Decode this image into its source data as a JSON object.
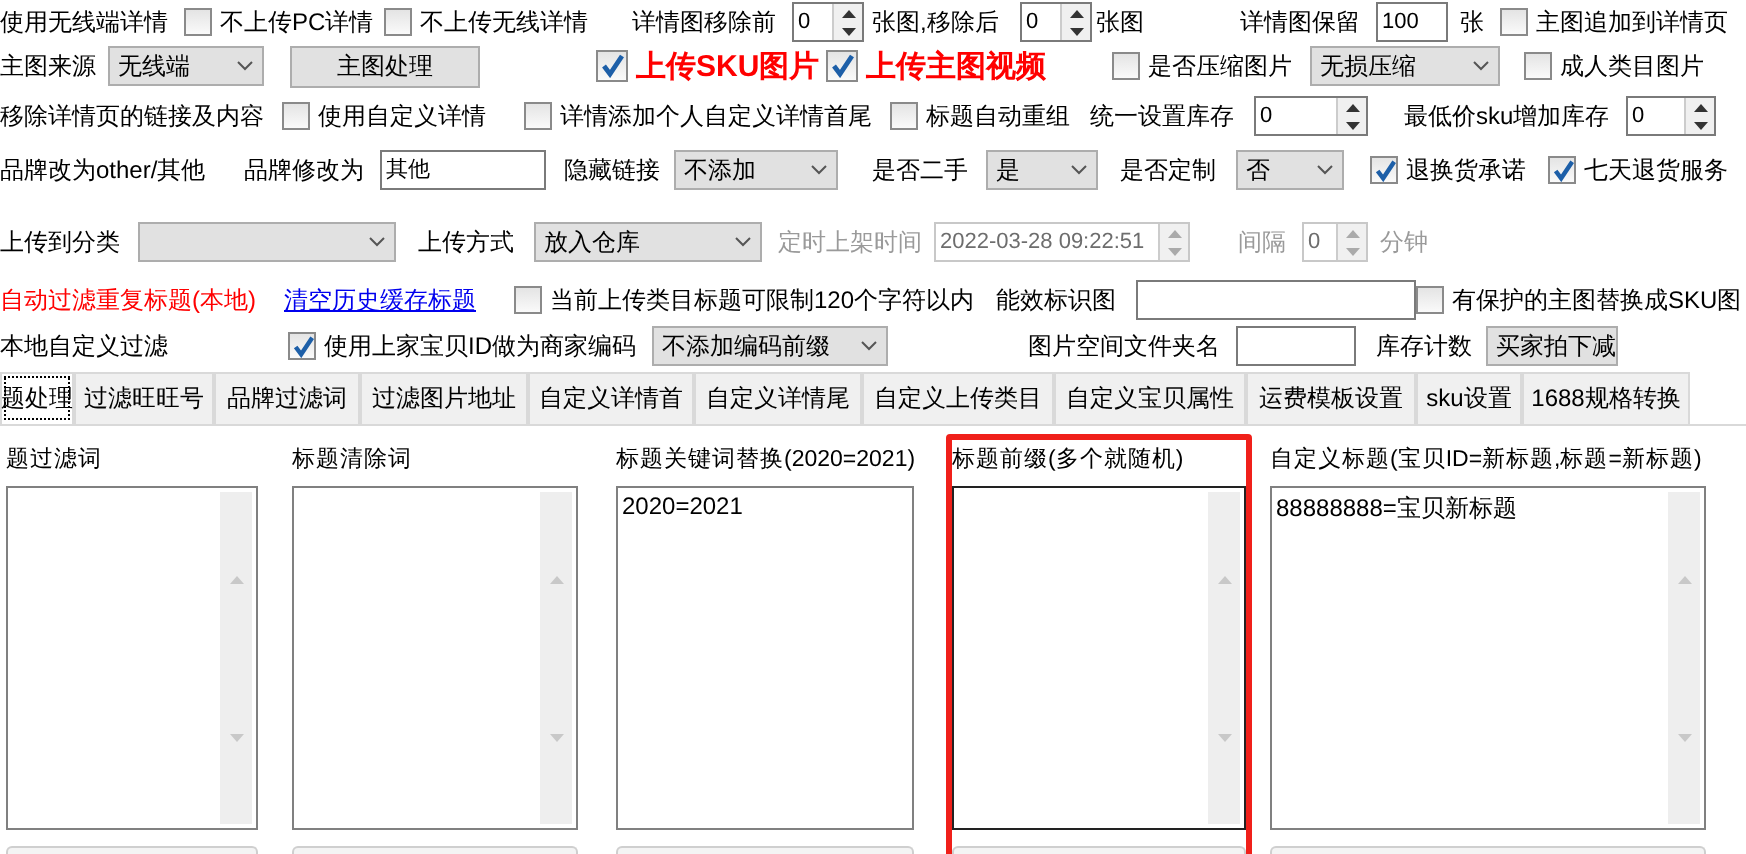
{
  "option_rows": [
    {
      "items": [
        {
          "kind": "label",
          "text": "使用无线端详情"
        },
        {
          "kind": "checkbox",
          "text": "不上传PC详情",
          "checked": false
        },
        {
          "kind": "checkbox",
          "text": "不上传无线详情",
          "checked": false
        },
        {
          "kind": "label",
          "text": "详情图移除前"
        },
        {
          "kind": "spin",
          "value": "0"
        },
        {
          "kind": "label",
          "text": "张图,移除后"
        },
        {
          "kind": "spin",
          "value": "0"
        },
        {
          "kind": "label",
          "text": "张图"
        },
        {
          "kind": "label",
          "text": "详情图保留"
        },
        {
          "kind": "input",
          "value": "100"
        },
        {
          "kind": "label",
          "text": "张"
        },
        {
          "kind": "checkbox",
          "text": "主图追加到详情页",
          "checked": false
        }
      ]
    },
    {
      "items": [
        {
          "kind": "label",
          "text": "主图来源"
        },
        {
          "kind": "select",
          "value": "无线端"
        },
        {
          "kind": "button",
          "text": "主图处理"
        },
        {
          "kind": "bigcheck",
          "text": "上传SKU图片",
          "checked": true
        },
        {
          "kind": "bigcheck",
          "text": "上传主图视频",
          "checked": true
        },
        {
          "kind": "checkbox",
          "text": "是否压缩图片",
          "checked": false
        },
        {
          "kind": "select",
          "value": "无损压缩"
        },
        {
          "kind": "checkbox",
          "text": "成人类目图片",
          "checked": false
        }
      ]
    },
    {
      "items": [
        {
          "kind": "label",
          "text": "移除详情页的链接及内容"
        },
        {
          "kind": "checkbox",
          "text": "使用自定义详情",
          "checked": false
        },
        {
          "kind": "checkbox",
          "text": "详情添加个人自定义详情首尾",
          "checked": false
        },
        {
          "kind": "checkbox",
          "text": "标题自动重组",
          "checked": false
        },
        {
          "kind": "label",
          "text": "统一设置库存"
        },
        {
          "kind": "spin",
          "value": "0"
        },
        {
          "kind": "label",
          "text": "最低价sku增加库存"
        },
        {
          "kind": "spin",
          "value": "0"
        }
      ]
    },
    {
      "items": [
        {
          "kind": "label",
          "text": "品牌改为other/其他"
        },
        {
          "kind": "label",
          "text": "品牌修改为"
        },
        {
          "kind": "input",
          "value": "其他"
        },
        {
          "kind": "label",
          "text": "隐藏链接"
        },
        {
          "kind": "select",
          "value": "不添加"
        },
        {
          "kind": "label",
          "text": "是否二手"
        },
        {
          "kind": "select",
          "value": "是"
        },
        {
          "kind": "label",
          "text": "是否定制"
        },
        {
          "kind": "select",
          "value": "否"
        },
        {
          "kind": "checkbox",
          "text": "退换货承诺",
          "checked": true
        },
        {
          "kind": "checkbox",
          "text": "七天退货服务",
          "checked": true
        }
      ]
    },
    {
      "items": [
        {
          "kind": "label",
          "text": "上传到分类"
        },
        {
          "kind": "select",
          "value": ""
        },
        {
          "kind": "label",
          "text": "上传方式"
        },
        {
          "kind": "select",
          "value": "放入仓库"
        },
        {
          "kind": "label",
          "text": "定时上架时间",
          "disabled": true
        },
        {
          "kind": "spin",
          "value": "2022-03-28 09:22:51",
          "disabled": true
        },
        {
          "kind": "label",
          "text": "间隔",
          "disabled": true
        },
        {
          "kind": "spin",
          "value": "0",
          "disabled": true
        },
        {
          "kind": "label",
          "text": "分钟",
          "disabled": true
        }
      ]
    },
    {
      "items": [
        {
          "kind": "warning",
          "text": "自动过滤重复标题(本地)"
        },
        {
          "kind": "link",
          "text": "清空历史缓存标题"
        },
        {
          "kind": "checkbox",
          "text": "当前上传类目标题可限制120个字符以内",
          "checked": false
        },
        {
          "kind": "label",
          "text": "能效标识图"
        },
        {
          "kind": "input",
          "value": ""
        },
        {
          "kind": "checkbox",
          "text": "有保护的主图替换成SKU图",
          "checked": false
        }
      ]
    },
    {
      "items": [
        {
          "kind": "label",
          "text": "本地自定义过滤"
        },
        {
          "kind": "checkbox",
          "text": "使用上家宝贝ID做为商家编码",
          "checked": true
        },
        {
          "kind": "select",
          "value": "不添加编码前缀"
        },
        {
          "kind": "label",
          "text": "图片空间文件夹名"
        },
        {
          "kind": "input",
          "value": ""
        },
        {
          "kind": "label",
          "text": "库存计数"
        },
        {
          "kind": "select",
          "value": "买家拍下减"
        }
      ]
    }
  ],
  "tabs": [
    {
      "label": "题处理",
      "selected": true
    },
    {
      "label": "过滤旺旺号",
      "selected": false
    },
    {
      "label": "品牌过滤词",
      "selected": false
    },
    {
      "label": "过滤图片地址",
      "selected": false
    },
    {
      "label": "自定义详情首",
      "selected": false
    },
    {
      "label": "自定义详情尾",
      "selected": false
    },
    {
      "label": "自定义上传类目",
      "selected": false
    },
    {
      "label": "自定义宝贝属性",
      "selected": false
    },
    {
      "label": "运费模板设置",
      "selected": false
    },
    {
      "label": "sku设置",
      "selected": false
    },
    {
      "label": "1688规格转换",
      "selected": false
    }
  ],
  "panels": [
    {
      "label": "题过滤词",
      "scrollbar": true,
      "highlighted": false
    },
    {
      "label": "标题清除词",
      "scrollbar": true,
      "highlighted": false
    },
    {
      "label": "标题关键词替换(2020=2021)",
      "value": "2020=2021",
      "scrollbar": false,
      "highlighted": false
    },
    {
      "label": "标题前缀(多个就随机)",
      "scrollbar": true,
      "highlighted": true
    },
    {
      "label": "自定义标题(宝贝ID=新标题,标题=新标题)",
      "value": "88888888=宝贝新标题",
      "scrollbar": true,
      "highlighted": false
    }
  ]
}
